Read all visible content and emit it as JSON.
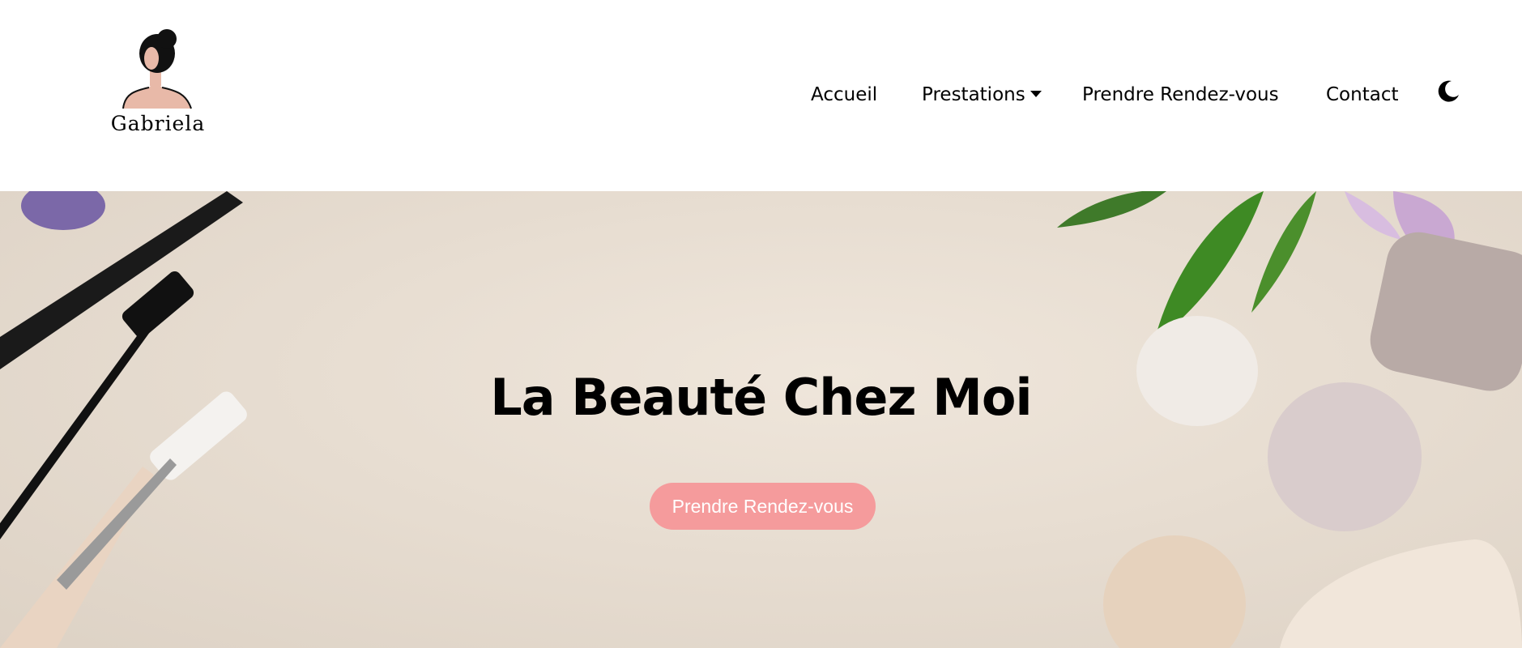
{
  "brand": {
    "name": "Gabriela"
  },
  "nav": {
    "items": [
      {
        "label": "Accueil"
      },
      {
        "label": "Prestations"
      },
      {
        "label": "Prendre Rendez-vous"
      },
      {
        "label": "Contact"
      }
    ],
    "theme_toggle_icon": "moon-icon"
  },
  "hero": {
    "title": "La Beauté Chez Moi",
    "cta_label": "Prendre Rendez-vous"
  },
  "colors": {
    "cta": "#f59b9c",
    "hero_bg": "#e7ddd1"
  }
}
